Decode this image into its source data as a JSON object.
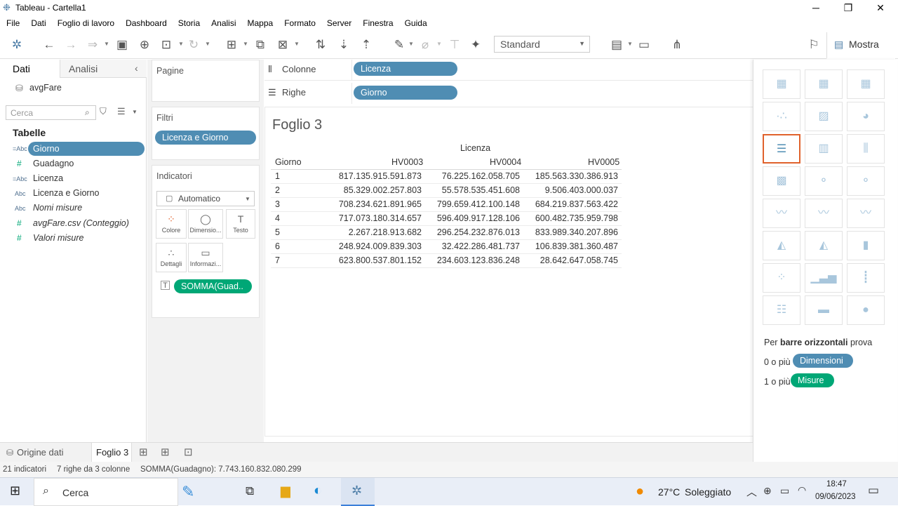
{
  "window": {
    "title": "Tableau - Cartella1",
    "minimize": "─",
    "maximize": "❐",
    "close": "✕"
  },
  "menu": [
    "File",
    "Dati",
    "Foglio di lavoro",
    "Dashboard",
    "Storia",
    "Analisi",
    "Mappa",
    "Formato",
    "Server",
    "Finestra",
    "Guida"
  ],
  "toolbar": {
    "fit_value": "Standard",
    "show_me_label": "Mostra"
  },
  "datapane": {
    "tabs": [
      "Dati",
      "Analisi"
    ],
    "datasource": "avgFare",
    "search_placeholder": "Cerca",
    "tables_heading": "Tabelle",
    "fields": [
      {
        "type": "=Abc",
        "name": "Giorno"
      },
      {
        "type": "#",
        "name": "Guadagno"
      },
      {
        "type": "=Abc",
        "name": "Licenza"
      },
      {
        "type": "Abc",
        "name": "Licenza e Giorno"
      },
      {
        "type": "Abc",
        "name": "Nomi misure"
      },
      {
        "type": "#",
        "name": "avgFare.csv (Conteggio)"
      },
      {
        "type": "#",
        "name": "Valori misure"
      }
    ]
  },
  "cards": {
    "pages": "Pagine",
    "filters": "Filtri",
    "filter_pill": "Licenza e Giorno",
    "marks": "Indicatori",
    "mark_type": "Automatico",
    "mark_buttons": [
      "Colore",
      "Dimensio...",
      "Testo",
      "Dettagli",
      "Informazi..."
    ],
    "mark_pill": "SOMMA(Guad.."
  },
  "shelves": {
    "columns_label": "Colonne",
    "columns_pill": "Licenza",
    "rows_label": "Righe",
    "rows_pill": "Giorno"
  },
  "view": {
    "sheet_title": "Foglio 3",
    "column_group_header": "Licenza",
    "row_header": "Giorno",
    "columns": [
      "HV0003",
      "HV0004",
      "HV0005"
    ],
    "rows": [
      {
        "day": "1",
        "values": [
          "817.135.915.591.873",
          "76.225.162.058.705",
          "185.563.330.386.913"
        ]
      },
      {
        "day": "2",
        "values": [
          "85.329.002.257.803",
          "55.578.535.451.608",
          "9.506.403.000.037"
        ]
      },
      {
        "day": "3",
        "values": [
          "708.234.621.891.965",
          "799.659.412.100.148",
          "684.219.837.563.422"
        ]
      },
      {
        "day": "4",
        "values": [
          "717.073.180.314.657",
          "596.409.917.128.106",
          "600.482.735.959.798"
        ]
      },
      {
        "day": "5",
        "values": [
          "2.267.218.913.682",
          "296.254.232.876.013",
          "833.989.340.207.896"
        ]
      },
      {
        "day": "6",
        "values": [
          "248.924.009.839.303",
          "32.422.286.481.737",
          "106.839.381.360.487"
        ]
      },
      {
        "day": "7",
        "values": [
          "623.800.537.801.152",
          "234.603.123.836.248",
          "28.642.647.058.745"
        ]
      }
    ]
  },
  "showme": {
    "hint_prefix": "Per",
    "hint_bold": "barre orizzontali",
    "hint_suffix": "prova",
    "dim_prefix": "0 o più",
    "dim_pill": "Dimensioni",
    "meas_prefix": "1 o più",
    "meas_pill": "Misure"
  },
  "bottom": {
    "datasource_tab": "Origine dati",
    "sheet_tab": "Foglio 3"
  },
  "status": {
    "marks": "21 indicatori",
    "shape": "7 righe da 3 colonne",
    "sum": "SOMMA(Guadagno): 7.743.160.832.080.299"
  },
  "taskbar": {
    "search": "Cerca",
    "weather_temp": "27°C",
    "weather_text": "Soleggiato",
    "time": "18:47",
    "date": "09/06/2023"
  }
}
